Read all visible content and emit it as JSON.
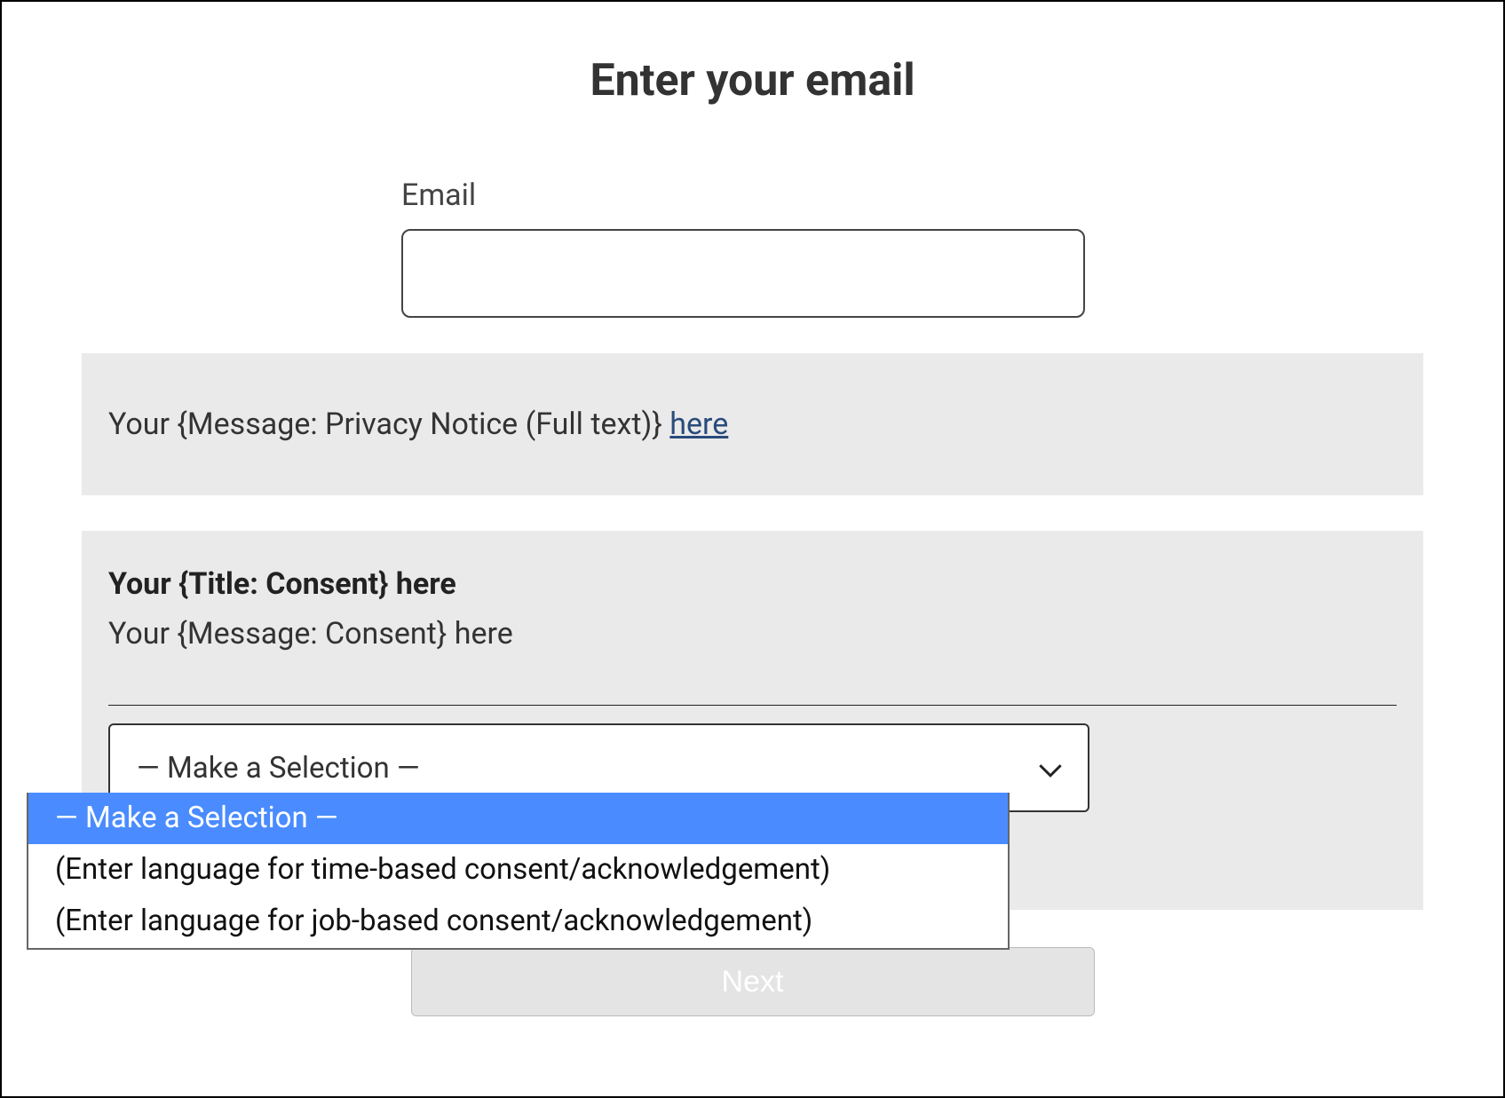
{
  "page": {
    "title": "Enter your email"
  },
  "email": {
    "label": "Email",
    "value": ""
  },
  "privacy": {
    "text_prefix": "Your {Message: Privacy Notice (Full text)} ",
    "link_text": "here"
  },
  "consent": {
    "title": "Your {Title: Consent} here",
    "message": "Your {Message: Consent} here",
    "select_display": "— Make a Selection —",
    "options": [
      "— Make a Selection —",
      "(Enter language for time-based consent/acknowledgement)",
      "(Enter language for job-based consent/acknowledgement)"
    ]
  },
  "buttons": {
    "next": "Next"
  },
  "colors": {
    "highlight": "#4a8cff",
    "panel_bg": "#eaeaea",
    "link": "#2a4b7c"
  }
}
